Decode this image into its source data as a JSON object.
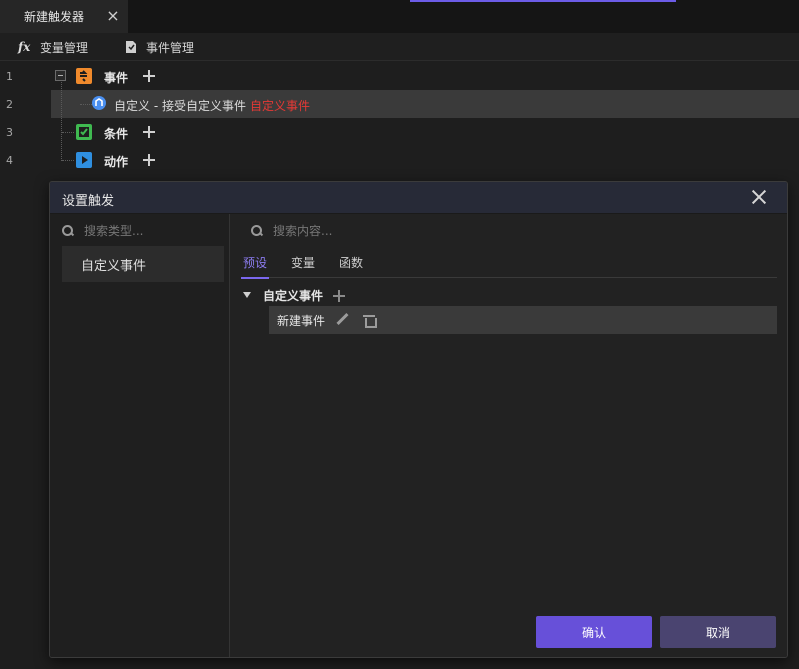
{
  "tab": {
    "title": "新建触发器",
    "close": "×"
  },
  "toolbar": {
    "variables_label": "变量管理",
    "variables_icon": "fx-icon",
    "events_label": "事件管理",
    "events_icon": "document-icon"
  },
  "tree": {
    "line_numbers": [
      "1",
      "2",
      "3",
      "4"
    ],
    "events_label": "事件",
    "event_item": {
      "text": "自定义 - 接受自定义事件",
      "suffix": "自定义事件",
      "suffix_color": "#e53935"
    },
    "conditions_label": "条件",
    "actions_label": "动作",
    "icon_colors": {
      "events": "#f08a2c",
      "conditions": "#3fb950",
      "actions": "#2f8fe0",
      "event_item": "#4a8ff0"
    }
  },
  "dialog": {
    "title": "设置触发",
    "left_search_placeholder": "搜索类型...",
    "categories": [
      "自定义事件"
    ],
    "right_search_placeholder": "搜索内容...",
    "tabs": [
      "预设",
      "变量",
      "函数"
    ],
    "active_tab": "预设",
    "group": {
      "label": "自定义事件",
      "items": [
        "新建事件"
      ]
    },
    "confirm_label": "确认",
    "cancel_label": "取消"
  },
  "colors": {
    "accent": "#7b68ee",
    "confirm": "#6750d9",
    "cancel": "#4a4470"
  }
}
